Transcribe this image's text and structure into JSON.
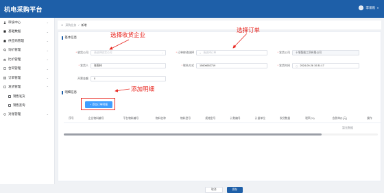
{
  "app": {
    "title": "机电采购平台",
    "user_name": "李采购"
  },
  "sidebar": {
    "items": [
      {
        "label": "审核中心",
        "icon": "user-icon"
      },
      {
        "label": "基础数据",
        "icon": "database-icon"
      },
      {
        "label": "供应商管理",
        "icon": "supplier-icon"
      },
      {
        "label": "询价管理",
        "icon": "inquiry-icon"
      },
      {
        "label": "比价管理",
        "icon": "compare-icon"
      },
      {
        "label": "合同管理",
        "icon": "contract-icon"
      },
      {
        "label": "订单管理",
        "icon": "order-icon"
      },
      {
        "label": "发货管理",
        "icon": "shipping-icon"
      }
    ],
    "sub_items": [
      {
        "label": "销售发货"
      },
      {
        "label": "销售查询"
      }
    ],
    "last_item": {
      "label": "对账管理",
      "icon": "reconcile-icon"
    }
  },
  "breadcrumb": {
    "home": "采购业务",
    "separator": "/",
    "current": "新增"
  },
  "form": {
    "section_basic": "基本信息",
    "receiver_company": {
      "label": "收货公司",
      "placeholder": "请选择收货公司"
    },
    "order_select": {
      "label": "订单修改选择",
      "placeholder": "请选择订单"
    },
    "sender_company": {
      "label": "发货公司",
      "value": "十堰智能工贸有限公司"
    },
    "sender": {
      "label": "发货人",
      "value": "张雨林"
    },
    "contact": {
      "label": "联系方式",
      "value": "15606652719"
    },
    "ship_time": {
      "label": "发货时间",
      "value": "2024-09-26 10:31:17"
    },
    "amount": {
      "label": "开票金额",
      "value": "0"
    }
  },
  "detail": {
    "section": "明细信息",
    "add_button": "+ 添加订单明细",
    "columns": [
      "序号",
      "企业物料编号",
      "平台物料编号",
      "物料名称",
      "物料型号",
      "规格型号",
      "计划编号",
      "计量单位",
      "发货数量",
      "税率(%)",
      "含税单价(元)",
      "操作"
    ],
    "empty_text": "暂无数据"
  },
  "footer": {
    "cancel": "取消",
    "save": "保存"
  },
  "annotations": {
    "receiver": "选择收货企业",
    "order": "选择订单",
    "detail": "添加明细"
  },
  "colors": {
    "brand": "#1e5fa8",
    "accent": "#409eff",
    "annotation": "#e8261f"
  }
}
